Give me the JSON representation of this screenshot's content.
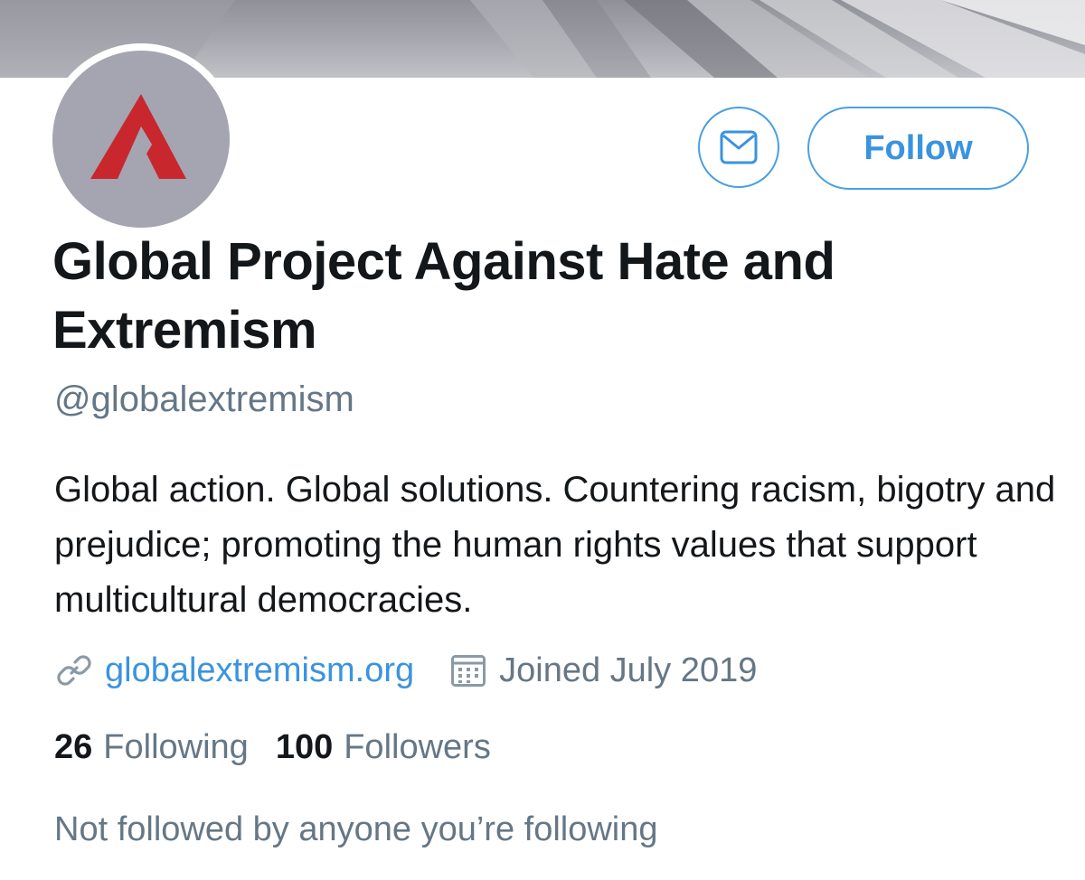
{
  "profile": {
    "display_name": "Global Project Against Hate and Extremism",
    "handle": "@globalextremism",
    "bio": "Global action. Global solutions. Countering racism, bigotry and prejudice; promoting the human rights values that support multicultural democracies.",
    "website": "globalextremism.org",
    "joined": "Joined July 2019"
  },
  "actions": {
    "follow_label": "Follow"
  },
  "stats": {
    "following_count": "26",
    "following_label": "Following",
    "followers_count": "100",
    "followers_label": "Followers"
  },
  "social_context": "Not followed by anyone you’re following",
  "icons": {
    "message": "envelope-icon",
    "website": "link-icon",
    "joined": "calendar-icon"
  },
  "colors": {
    "accent": "#3a93df",
    "secondary_text": "#657786",
    "primary_text": "#14171a",
    "avatar_bg": "#a4a5b1",
    "logo_red": "#c9272e"
  }
}
